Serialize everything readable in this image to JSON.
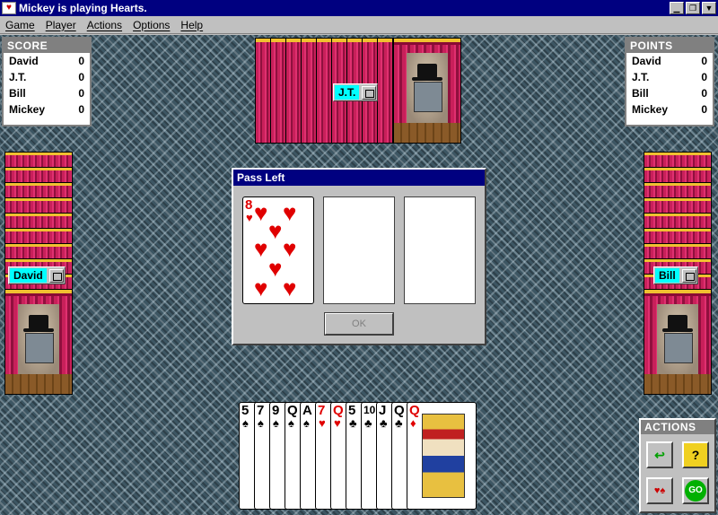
{
  "window": {
    "title": "Mickey is playing Hearts.",
    "minimize": "▁",
    "restore": "❐",
    "close": "▼"
  },
  "menu": [
    {
      "label": "Game"
    },
    {
      "label": "Player"
    },
    {
      "label": "Actions"
    },
    {
      "label": "Options"
    },
    {
      "label": "Help"
    }
  ],
  "score": {
    "header": "SCORE",
    "rows": [
      {
        "name": "David",
        "value": "0"
      },
      {
        "name": "J.T.",
        "value": "0"
      },
      {
        "name": "Bill",
        "value": "0"
      },
      {
        "name": "Mickey",
        "value": "0"
      }
    ]
  },
  "points": {
    "header": "POINTS",
    "rows": [
      {
        "name": "David",
        "value": "0"
      },
      {
        "name": "J.T.",
        "value": "0"
      },
      {
        "name": "Bill",
        "value": "0"
      },
      {
        "name": "Mickey",
        "value": "0"
      }
    ]
  },
  "players": {
    "north": "J.T.",
    "west": "David",
    "east": "Bill"
  },
  "dialog": {
    "title": "Pass Left",
    "ok_label": "OK",
    "selected_card": {
      "rank": "8",
      "suit": "♥"
    }
  },
  "hand": [
    {
      "rank": "5",
      "suit": "♠"
    },
    {
      "rank": "7",
      "suit": "♠"
    },
    {
      "rank": "9",
      "suit": "♠"
    },
    {
      "rank": "Q",
      "suit": "♠"
    },
    {
      "rank": "A",
      "suit": "♠"
    },
    {
      "rank": "7",
      "suit": "♥"
    },
    {
      "rank": "Q",
      "suit": "♥"
    },
    {
      "rank": "5",
      "suit": "♣"
    },
    {
      "rank": "10",
      "suit": "♣"
    },
    {
      "rank": "J",
      "suit": "♣"
    },
    {
      "rank": "Q",
      "suit": "♣"
    },
    {
      "rank": "Q",
      "suit": "♦"
    }
  ],
  "actions": {
    "header": "ACTIONS",
    "go_label": "GO",
    "help_label": "?"
  },
  "colors": {
    "title_bar": "#000080",
    "name_tag": "#00ffff",
    "heart": "#e00000",
    "card_back": "#b01050"
  }
}
